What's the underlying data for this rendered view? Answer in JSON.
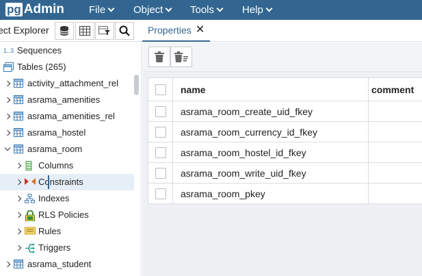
{
  "app": {
    "logo_pg": "pg",
    "logo_admin": "Admin"
  },
  "menu": [
    "File",
    "Object",
    "Tools",
    "Help"
  ],
  "left_panel": {
    "title": "ect Explorer",
    "tree": [
      {
        "label": "Sequences",
        "prefix": "1..3",
        "icon": "sequence-icon",
        "indent": 0,
        "twisty": "none"
      },
      {
        "label": "Tables (265)",
        "icon": "tables-icon",
        "indent": 0,
        "twisty": "none"
      },
      {
        "label": "activity_attachment_rel",
        "icon": "table-icon",
        "indent": 1,
        "twisty": "closed"
      },
      {
        "label": "asrama_amenities",
        "icon": "table-icon",
        "indent": 1,
        "twisty": "closed"
      },
      {
        "label": "asrama_amenities_rel",
        "icon": "table-icon",
        "indent": 1,
        "twisty": "closed"
      },
      {
        "label": "asrama_hostel",
        "icon": "table-icon",
        "indent": 1,
        "twisty": "closed"
      },
      {
        "label": "asrama_room",
        "icon": "table-icon",
        "indent": 1,
        "twisty": "open"
      },
      {
        "label": "Columns",
        "icon": "columns-icon",
        "indent": 2,
        "twisty": "closed"
      },
      {
        "label": "Constraints",
        "icon": "constraints-icon",
        "indent": 2,
        "twisty": "closed",
        "selected": true
      },
      {
        "label": "Indexes",
        "icon": "indexes-icon",
        "indent": 2,
        "twisty": "closed"
      },
      {
        "label": "RLS Policies",
        "icon": "rls-policies-icon",
        "indent": 2,
        "twisty": "closed"
      },
      {
        "label": "Rules",
        "icon": "rules-icon",
        "indent": 2,
        "twisty": "closed"
      },
      {
        "label": "Triggers",
        "icon": "triggers-icon",
        "indent": 2,
        "twisty": "closed"
      },
      {
        "label": "asrama_student",
        "icon": "table-icon",
        "indent": 1,
        "twisty": "closed"
      }
    ]
  },
  "properties": {
    "tab_label": "Properties",
    "columns": [
      "name",
      "comment"
    ],
    "rows": [
      {
        "name": "asrama_room_create_uid_fkey",
        "comment": ""
      },
      {
        "name": "asrama_room_currency_id_fkey",
        "comment": ""
      },
      {
        "name": "asrama_room_hostel_id_fkey",
        "comment": ""
      },
      {
        "name": "asrama_room_write_uid_fkey",
        "comment": ""
      },
      {
        "name": "asrama_room_pkey",
        "comment": ""
      }
    ]
  },
  "colors": {
    "menubar": "#326690",
    "accent": "#326690",
    "selected_row": "#e6eef8",
    "table_icon": "#3a79b5"
  }
}
